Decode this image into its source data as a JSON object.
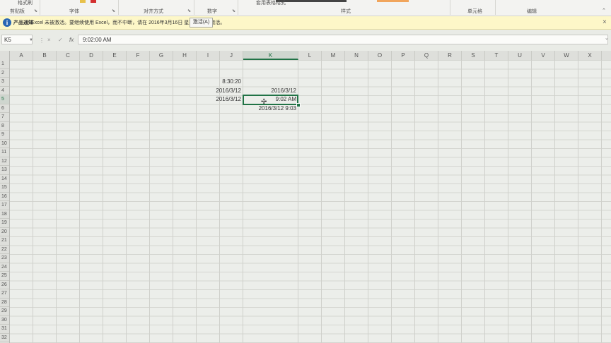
{
  "ribbon": {
    "groups": [
      {
        "label": "剪贴板"
      },
      {
        "label": "字体"
      },
      {
        "label": "对齐方式"
      },
      {
        "label": "数字"
      },
      {
        "label": "样式"
      },
      {
        "label": "单元格"
      },
      {
        "label": "编辑"
      }
    ],
    "format_painter_label": "格式刷",
    "table_format_label": "套用表格格式"
  },
  "message_bar": {
    "title": "产品通知",
    "text": "Excel 未被激活。要继续使用 Excel，而不中断，请在 2016年3月16日 星期三 之前激活。",
    "activate_label": "激活(A)",
    "close_glyph": "×"
  },
  "formula_bar": {
    "name_box": "K5",
    "cancel_glyph": "×",
    "enter_glyph": "✓",
    "fx_glyph": "fx",
    "value": "9:02:00 AM"
  },
  "columns": [
    "A",
    "B",
    "C",
    "D",
    "E",
    "F",
    "G",
    "H",
    "I",
    "J",
    "K",
    "L",
    "M",
    "N",
    "O",
    "P",
    "Q",
    "R",
    "S",
    "T",
    "U",
    "V",
    "W",
    "X"
  ],
  "rows": [
    "1",
    "2",
    "3",
    "4",
    "5",
    "6",
    "7",
    "8",
    "9",
    "10",
    "11",
    "12",
    "13",
    "14",
    "15",
    "16",
    "17",
    "18",
    "19",
    "20",
    "21",
    "22",
    "23",
    "24",
    "25",
    "26",
    "27",
    "28",
    "29",
    "30",
    "31",
    "32"
  ],
  "cells": {
    "J3": "8:30:20",
    "J4": "2016/3/12",
    "K4": "2016/3/12",
    "J5": "2016/3/12",
    "K5": "9:02 AM",
    "K6": "2016/3/12 9:03"
  },
  "active_cell": "K5",
  "colors": {
    "accent": "#217346",
    "message_bar": "#fdf7c8"
  }
}
